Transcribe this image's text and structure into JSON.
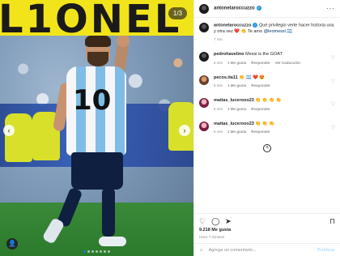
{
  "media": {
    "headline": "L1ONEL",
    "counter": "1/3",
    "jersey_number": "10",
    "slide_count": 7,
    "active_slide": 1
  },
  "header": {
    "username": "antonelaroccuzzo",
    "more": "···"
  },
  "caption": {
    "username": "antonelaroccuzzo",
    "text_prefix": "Qué privilegio verte hacer historia una y otra vez ❤️ 👏 Te amo ",
    "mention": "@leomessi",
    "time": "7 min"
  },
  "comments": [
    {
      "username": "pedrohavelino",
      "text": "Messi is the GOAT",
      "time": "6 min",
      "likes": "1 Me gusta",
      "reply": "Responder",
      "translate": "Ver traducción",
      "avatar": "dark"
    },
    {
      "username": "pecos.ita11",
      "text": "👏 🇦🇷 ❤️ 😍",
      "time": "6 min",
      "likes": "1 Me gusta",
      "reply": "Responder",
      "translate": "",
      "avatar": "warm"
    },
    {
      "username": "matias_lucerooo23",
      "text": "👏 👏 👏 👏",
      "time": "6 min",
      "likes": "1 Me gusta",
      "reply": "Responder",
      "translate": "",
      "avatar": "pink"
    },
    {
      "username": "matias_lucerooo23",
      "text": "👏 👏 👏",
      "time": "6 min",
      "likes": "1 Me gusta",
      "reply": "Responder",
      "translate": "",
      "avatar": "pink"
    }
  ],
  "stats": {
    "likes": "9.218 Me gusta",
    "time": "Hace 7 minutos"
  },
  "add_comment": {
    "placeholder": "Agrega un comentario...",
    "publish": "Publicar"
  }
}
